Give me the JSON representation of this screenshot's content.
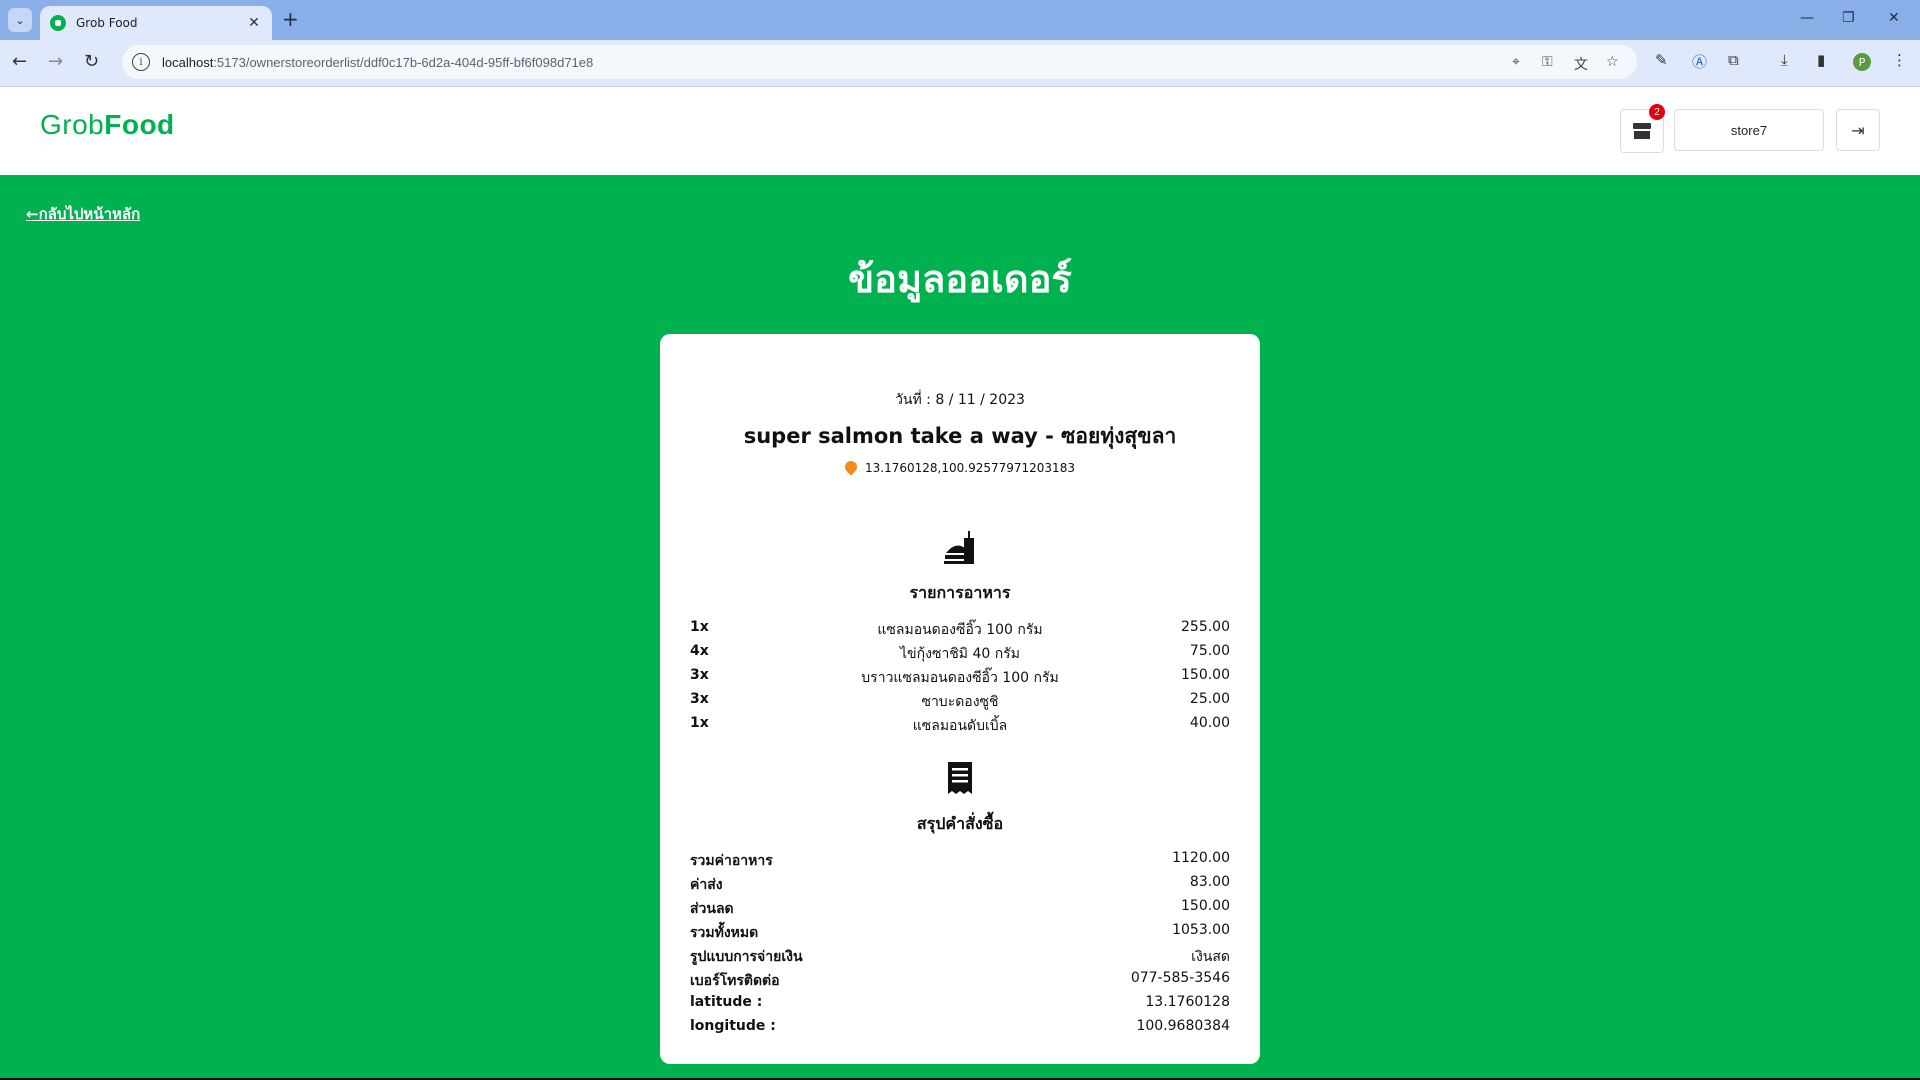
{
  "browser": {
    "tab_title": "Grob Food",
    "url_host": "localhost",
    "url_rest": ":5173/ownerstoreorderlist/ddf0c17b-6d2a-404d-95ff-bf6f098d71e8",
    "profile_initial": "P"
  },
  "header": {
    "logo_part1": "Grob",
    "logo_part2": "Food",
    "cart_badge": "2",
    "store_name": "store7"
  },
  "main": {
    "back_link": "←กลับไปหน้าหลัก",
    "page_title": "ข้อมูลออเดอร์"
  },
  "order": {
    "date": "วันที่ : 8 / 11 / 2023",
    "store": "super salmon take a way - ซอยทุ่งสุขลา",
    "coords": "13.1760128,100.92577971203183",
    "items_title": "รายการอาหาร",
    "items": [
      {
        "qty": "1x",
        "name": "แซลมอนดองซีอิ๊ว 100 กรัม",
        "price": "255.00"
      },
      {
        "qty": "4x",
        "name": "ไข่กุ้งซาชิมิ 40 กรัม",
        "price": "75.00"
      },
      {
        "qty": "3x",
        "name": "บราวแซลมอนดองซีอิ๊ว 100 กรัม",
        "price": "150.00"
      },
      {
        "qty": "3x",
        "name": "ซาบะดองซูชิ",
        "price": "25.00"
      },
      {
        "qty": "1x",
        "name": "แซลมอนดับเบิ้ล",
        "price": "40.00"
      }
    ],
    "summary_title": "สรุปคำสั่งซื้อ",
    "summary": [
      {
        "label": "รวมค่าอาหาร",
        "value": "1120.00"
      },
      {
        "label": "ค่าส่ง",
        "value": "83.00"
      },
      {
        "label": "ส่วนลด",
        "value": "150.00"
      },
      {
        "label": "รวมทั้งหมด",
        "value": "1053.00"
      },
      {
        "label": "รูปแบบการจ่ายเงิน",
        "value": "เงินสด"
      },
      {
        "label": "เบอร์โทรติดต่อ",
        "value": "077-585-3546"
      },
      {
        "label": "latitude :",
        "value": "13.1760128"
      },
      {
        "label": "longitude :",
        "value": "100.9680384"
      }
    ]
  },
  "colors": {
    "brand_green": "#00b14f",
    "pin_orange": "#f28b1c",
    "badge_red": "#e3000f"
  },
  "icons": [
    "search-icon",
    "star-icon",
    "store-icon",
    "logout-icon",
    "food-icon",
    "receipt-icon",
    "location-pin-icon"
  ]
}
